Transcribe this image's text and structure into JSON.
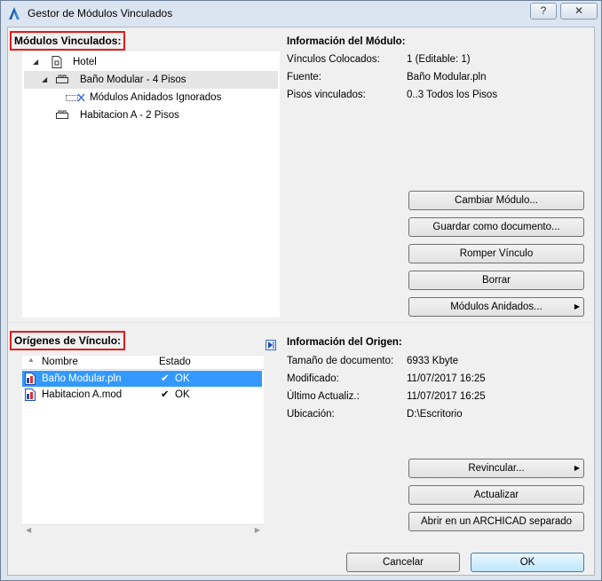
{
  "window": {
    "title": "Gestor de Módulos Vinculados",
    "help_label": "?",
    "close_label": "✕"
  },
  "linked_modules": {
    "label": "Módulos Vinculados:",
    "tree": [
      {
        "label": "Hotel"
      },
      {
        "label": "Baño Modular - 4 Pisos"
      },
      {
        "label": "Módulos Anidados Ignorados"
      },
      {
        "label": "Habitacion A - 2 Pisos"
      }
    ]
  },
  "module_info": {
    "title": "Información del Módulo:",
    "rows": [
      {
        "label": "Vínculos Colocados:",
        "value": "1 (Editable: 1)"
      },
      {
        "label": "Fuente:",
        "value": "Baño Modular.pln"
      },
      {
        "label": "Pisos vinculados:",
        "value": "0..3 Todos los Pisos"
      }
    ],
    "buttons": {
      "change": "Cambiar Módulo...",
      "save_as": "Guardar como documento...",
      "break_link": "Romper Vínculo",
      "delete": "Borrar",
      "nested": "Módulos Anidados..."
    }
  },
  "link_sources": {
    "label": "Orígenes de Vínculo:",
    "columns": {
      "name": "Nombre",
      "status": "Estado"
    },
    "rows": [
      {
        "name": "Baño Modular.pln",
        "status": "OK"
      },
      {
        "name": "Habitacion A.mod",
        "status": "OK"
      }
    ]
  },
  "source_info": {
    "title": "Información del Origen:",
    "rows": [
      {
        "label": "Tamaño de documento:",
        "value": "6933 Kbyte"
      },
      {
        "label": "Modificado:",
        "value": "11/07/2017 16:25"
      },
      {
        "label": "Último Actualiz.:",
        "value": "11/07/2017 16:25"
      },
      {
        "label": "Ubicación:",
        "value": "D:\\Escritorio"
      }
    ],
    "buttons": {
      "relink": "Revincular...",
      "update": "Actualizar",
      "open_separate": "Abrir en un ARCHICAD separado"
    }
  },
  "footer": {
    "cancel": "Cancelar",
    "ok": "OK"
  }
}
